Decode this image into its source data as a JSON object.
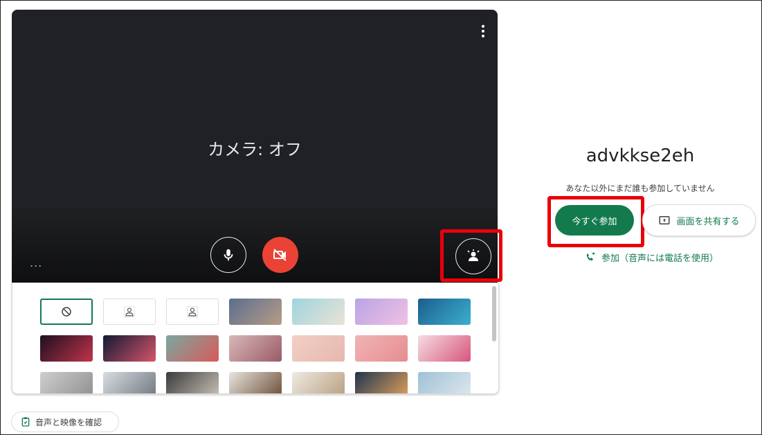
{
  "preview": {
    "camera_status": "カメラ: オフ",
    "ellipsis": "...",
    "icons": {
      "more": "more-vert-icon",
      "mic": "mic-icon",
      "camera": "videocam-off-icon",
      "effects": "visual-effects-icon"
    }
  },
  "backgrounds": {
    "tiles": [
      {
        "kind": "none",
        "icon": "block-icon"
      },
      {
        "kind": "blur-slight",
        "icon": "person-blur-icon"
      },
      {
        "kind": "blur",
        "icon": "person-blur-icon"
      },
      {
        "kind": "image",
        "colors": [
          "#5a6f8e",
          "#b79b87"
        ]
      },
      {
        "kind": "image",
        "colors": [
          "#9fd4de",
          "#e9e3d6"
        ]
      },
      {
        "kind": "image",
        "colors": [
          "#b8a4e6",
          "#f1c0e3"
        ]
      },
      {
        "kind": "image",
        "colors": [
          "#1c5d8d",
          "#3ab0cf"
        ]
      },
      {
        "kind": "image",
        "colors": [
          "#1b1020",
          "#c2334b"
        ]
      },
      {
        "kind": "image",
        "colors": [
          "#0f1a33",
          "#d8546b"
        ]
      },
      {
        "kind": "image",
        "colors": [
          "#7aa8a0",
          "#d85a5a"
        ]
      },
      {
        "kind": "image",
        "colors": [
          "#d8b8ba",
          "#9a5b66"
        ]
      },
      {
        "kind": "image",
        "colors": [
          "#f2cfc6",
          "#e7b8ad"
        ]
      },
      {
        "kind": "image",
        "colors": [
          "#f1b4b4",
          "#e58d91"
        ]
      },
      {
        "kind": "image",
        "colors": [
          "#f6dde2",
          "#d7567d"
        ]
      },
      {
        "kind": "image",
        "colors": [
          "#cfcfcf",
          "#8f8f8f"
        ]
      },
      {
        "kind": "image",
        "colors": [
          "#d9dde2",
          "#707780"
        ]
      },
      {
        "kind": "image",
        "colors": [
          "#3b3b3b",
          "#c9c3b7"
        ]
      },
      {
        "kind": "image",
        "colors": [
          "#e9e5de",
          "#6b4c35"
        ]
      },
      {
        "kind": "image",
        "colors": [
          "#efeae3",
          "#b79e7e"
        ]
      },
      {
        "kind": "image",
        "colors": [
          "#1f3550",
          "#e1a15b"
        ]
      },
      {
        "kind": "image",
        "colors": [
          "#9ec1d6",
          "#dfe8ee"
        ]
      }
    ]
  },
  "meeting": {
    "code": "advkkse2eh",
    "status": "あなた以外にまだ誰も参加していません",
    "join_label": "今すぐ参加",
    "share_label": "画面を共有する",
    "phone_label": "参加（音声には電話を使用）"
  },
  "footer": {
    "check_label": "音声と映像を確認"
  },
  "colors": {
    "accent": "#137a4e",
    "danger": "#ea4335",
    "highlight": "#e8000b",
    "preview_bg": "#202124"
  }
}
